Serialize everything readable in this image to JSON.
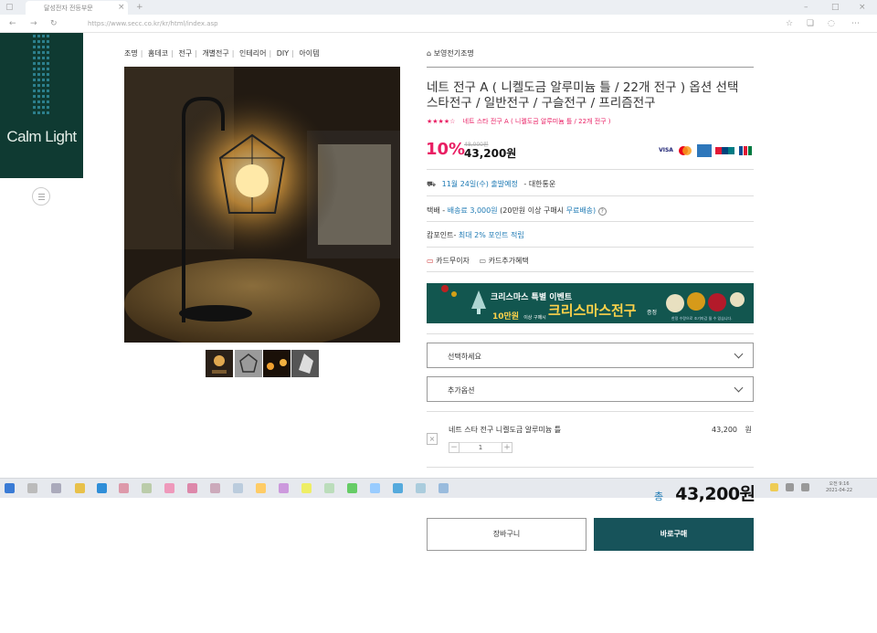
{
  "browser": {
    "tab_title": "달성전자 전등부문",
    "url": "https://www.secc.co.kr/kr/html/index.asp"
  },
  "logo": {
    "text": "Calm Light"
  },
  "breadcrumb": [
    "조명",
    "홈데코",
    "전구",
    "개별전구",
    "인테리어",
    "DIY",
    "아이템"
  ],
  "product": {
    "brand": "보영전기조명",
    "title": "네트 전구 A ( 니켈도금 알루미늄 틀 / 22개 전구 ) 옵션 선택 스타전구 / 일반전구 / 구슬전구 / 프리즘전구",
    "stars": "★★★★☆",
    "subtitle": "네트 스타 전구 A ( 니켈도금 알루미늄 틀 / 22개 전구 )",
    "discount": "10%",
    "original_price": "48,000원",
    "price": "43,200원"
  },
  "payment_logos": [
    "VISA",
    "MC",
    "AMEX",
    "UnionPay",
    "JCB"
  ],
  "shipping": {
    "date": "11월 24일(수) 출발예정",
    "carrier": "- 대한통운",
    "fee_label": "택배 -",
    "fee": "배송료 3,000원",
    "fee_note": "(20만원 이상 구매시",
    "free": "무료배송)",
    "help": "?"
  },
  "points": {
    "label": "캄포인트-",
    "value": "최대 2% 포인트 적립"
  },
  "card_benefits": {
    "installment": "카드무이자",
    "extra": "카드추가혜택"
  },
  "banner": {
    "title": "크리스마스 특별 이벤트",
    "amount": "10만원",
    "condition": "이상 구매시",
    "highlight": "크리스마스전구",
    "gift": "증정",
    "fine_print": "한정 수량으로 조기마감 될 수 있습니다."
  },
  "options": {
    "select_placeholder": "선택하세요",
    "additional_placeholder": "추가옵션"
  },
  "selected_option": {
    "name": "네트 스타 전구 니켈도금 알루미늄 틀",
    "quantity": "1",
    "price": "43,200",
    "unit": "원",
    "remove": "×",
    "minus": "−",
    "plus": "+"
  },
  "total": {
    "label": "총",
    "amount": "43,200원"
  },
  "actions": {
    "cart": "장바구니",
    "buy": "바로구매"
  },
  "taskbar": {
    "time": "오전 9:16",
    "date": "2021-04-22"
  },
  "colors": {
    "accent": "#e91e63",
    "brand_teal": "#17535a",
    "link": "#1e7ab4",
    "logo_bg": "#0f3a32"
  }
}
